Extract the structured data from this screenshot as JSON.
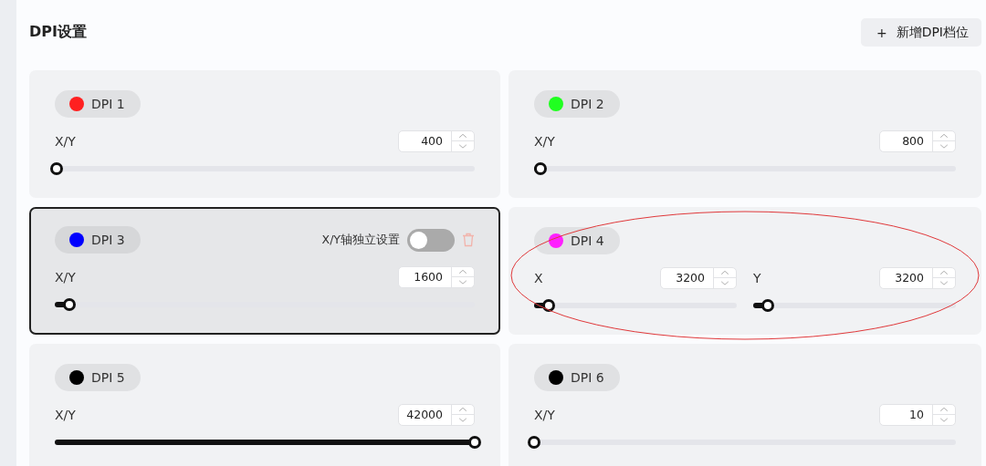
{
  "page": {
    "title": "DPI设置",
    "add_button": {
      "icon": "+",
      "label": "新增DPI档位"
    }
  },
  "cards": [
    {
      "name": "DPI 1",
      "color": "#ff2020",
      "selected": false,
      "circled": false,
      "axes": [
        {
          "label": "X/Y",
          "value": "400",
          "level": 0.005
        }
      ]
    },
    {
      "name": "DPI 2",
      "color": "#20ff20",
      "selected": false,
      "circled": false,
      "axes": [
        {
          "label": "X/Y",
          "value": "800",
          "level": 0.015
        }
      ]
    },
    {
      "name": "DPI 3",
      "color": "#0000ff",
      "selected": true,
      "circled": false,
      "toggle": {
        "label": "X/Y轴独立设置",
        "on": false
      },
      "axes": [
        {
          "label": "X/Y",
          "value": "1600",
          "level": 0.035
        }
      ]
    },
    {
      "name": "DPI 4",
      "color": "#ff20ff",
      "selected": false,
      "circled": true,
      "axes": [
        {
          "label": "X",
          "value": "3200",
          "level": 0.07
        },
        {
          "label": "Y",
          "value": "3200",
          "level": 0.07
        }
      ]
    },
    {
      "name": "DPI 5",
      "color": "#000000",
      "selected": false,
      "circled": false,
      "axes": [
        {
          "label": "X/Y",
          "value": "42000",
          "level": 1
        }
      ]
    },
    {
      "name": "DPI 6",
      "color": "#000000",
      "selected": false,
      "circled": false,
      "axes": [
        {
          "label": "X/Y",
          "value": "10",
          "level": 0
        }
      ]
    }
  ]
}
